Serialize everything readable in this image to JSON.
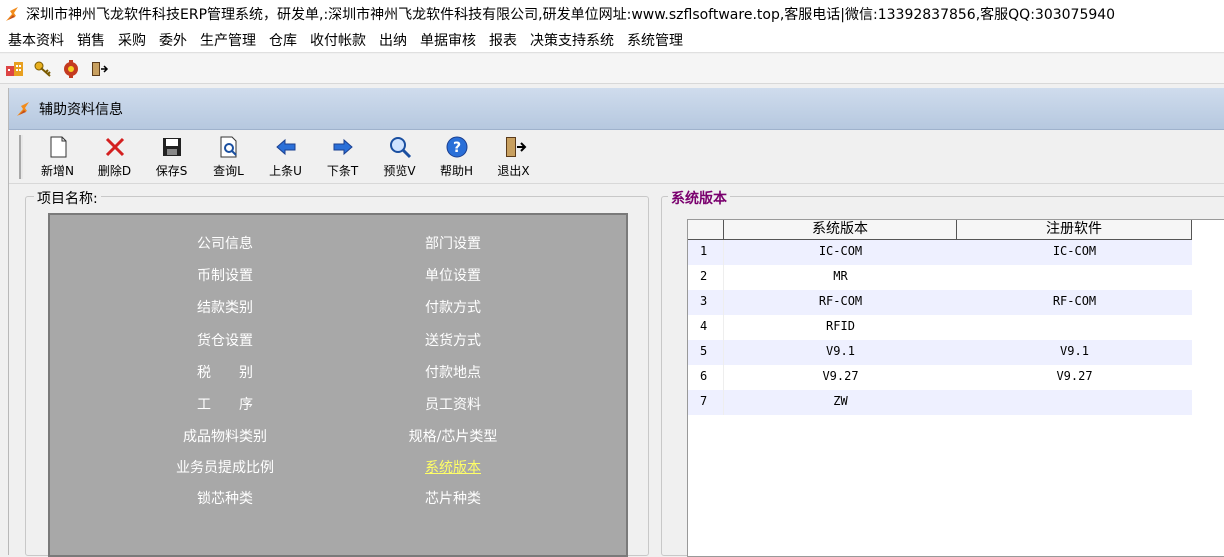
{
  "window": {
    "title": "深圳市神州飞龙软件科技ERP管理系统，研发单,:深圳市神州飞龙软件科技有限公司,研发单位网址:www.szflsoftware.top,客服电话|微信:13392837856,客服QQ:303075940"
  },
  "menu": [
    "基本资料",
    "销售",
    "采购",
    "委外",
    "生产管理",
    "仓库",
    "收付帐款",
    "出纳",
    "单据审核",
    "报表",
    "决策支持系统",
    "系统管理"
  ],
  "quick_icons": [
    "company-icon",
    "key-icon",
    "gear-icon",
    "exit-icon"
  ],
  "child": {
    "title": "辅助资料信息"
  },
  "toolbar": [
    {
      "label": "新增N",
      "icon": "new-doc-icon"
    },
    {
      "label": "删除D",
      "icon": "delete-icon"
    },
    {
      "label": "保存S",
      "icon": "save-icon"
    },
    {
      "label": "查询L",
      "icon": "query-icon"
    },
    {
      "label": "上条U",
      "icon": "arrow-left-icon"
    },
    {
      "label": "下条T",
      "icon": "arrow-right-icon"
    },
    {
      "label": "预览V",
      "icon": "preview-icon"
    },
    {
      "label": "帮助H",
      "icon": "help-icon"
    },
    {
      "label": "退出X",
      "icon": "exit-icon"
    }
  ],
  "items_panel": {
    "legend": "项目名称:",
    "left_col": [
      "公司信息",
      "币制设置",
      "结款类别",
      "货仓设置",
      "税　　别",
      "工　　序",
      "成品物料类别",
      "业务员提成比例",
      "锁芯种类"
    ],
    "right_col": [
      "部门设置",
      "单位设置",
      "付款方式",
      "送货方式",
      "付款地点",
      "员工资料",
      "规格/芯片类型",
      "系统版本",
      "芯片种类"
    ],
    "selected": "系统版本"
  },
  "version_panel": {
    "legend": "系统版本",
    "columns": [
      "系统版本",
      "注册软件"
    ],
    "rows": [
      {
        "no": "1",
        "version": "IC-COM",
        "registered": "IC-COM"
      },
      {
        "no": "2",
        "version": "MR",
        "registered": ""
      },
      {
        "no": "3",
        "version": "RF-COM",
        "registered": "RF-COM"
      },
      {
        "no": "4",
        "version": "RFID",
        "registered": ""
      },
      {
        "no": "5",
        "version": "V9.1",
        "registered": "V9.1"
      },
      {
        "no": "6",
        "version": "V9.27",
        "registered": "V9.27"
      },
      {
        "no": "7",
        "version": "ZW",
        "registered": ""
      }
    ]
  }
}
